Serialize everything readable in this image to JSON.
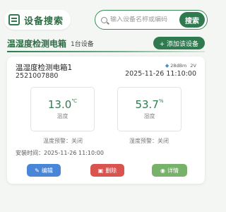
{
  "header": {
    "title": "设备搜索",
    "search_placeholder": "输入设备名称或编码",
    "search_button": "搜索"
  },
  "section": {
    "box_name": "温湿度检测电箱",
    "count": "1台设备",
    "add_button": "+ 添加该设备"
  },
  "device": {
    "name": "温湿度检测电箱1",
    "serial": "2521007880",
    "signal": "28dBm",
    "voltage": "2V",
    "time": "2025-11-26 11:10:00",
    "temperature": {
      "value": "13.0",
      "unit": "℃",
      "label": "温度"
    },
    "humidity": {
      "value": "53.7",
      "unit": "%",
      "label": "湿度"
    },
    "temp_alarm": "温度预警：关闭",
    "hum_alarm": "湿度预警：关闭",
    "install_time": "安装时间：2025-11-26 11:10:00"
  },
  "actions": {
    "edit": "编辑",
    "delete": "删除",
    "detail": "详情"
  }
}
